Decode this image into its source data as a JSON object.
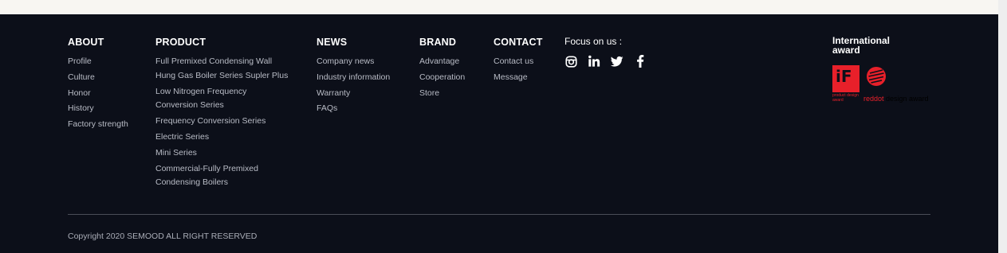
{
  "columns": {
    "about": {
      "title": "ABOUT",
      "items": [
        "Profile",
        "Culture",
        "Honor",
        "History",
        "Factory strength"
      ]
    },
    "product": {
      "title": "PRODUCT",
      "items": [
        "Full Premixed Condensing Wall Hung Gas Boiler Series Supler Plus",
        "Low Nitrogen Frequency Conversion Series",
        "Frequency Conversion Series",
        "Electric Series",
        "Mini Series",
        "Commercial-Fully Premixed Condensing Boilers"
      ]
    },
    "news": {
      "title": "NEWS",
      "items": [
        "Company news",
        "Industry information",
        "Warranty",
        "FAQs"
      ]
    },
    "brand": {
      "title": "BRAND",
      "items": [
        "Advantage",
        "Cooperation",
        "Store"
      ]
    },
    "contact": {
      "title": "CONTACT",
      "items": [
        "Contact us",
        "Message"
      ]
    }
  },
  "follow": {
    "label": "Focus on us :",
    "icons": [
      "instagram-icon",
      "linkedin-icon",
      "twitter-icon",
      "facebook-icon"
    ]
  },
  "award": {
    "title": "International award",
    "if_text": "iF",
    "if_caption": "product design award",
    "reddot_prefix": "red",
    "reddot_mid": "dot",
    "reddot_suffix": " design award"
  },
  "copyright": "Copyright 2020 SEMOOD ALL RIGHT RESERVED",
  "colors": {
    "background": "#0c0f19",
    "accent": "#e8202a",
    "text": "#b9bcc6"
  }
}
